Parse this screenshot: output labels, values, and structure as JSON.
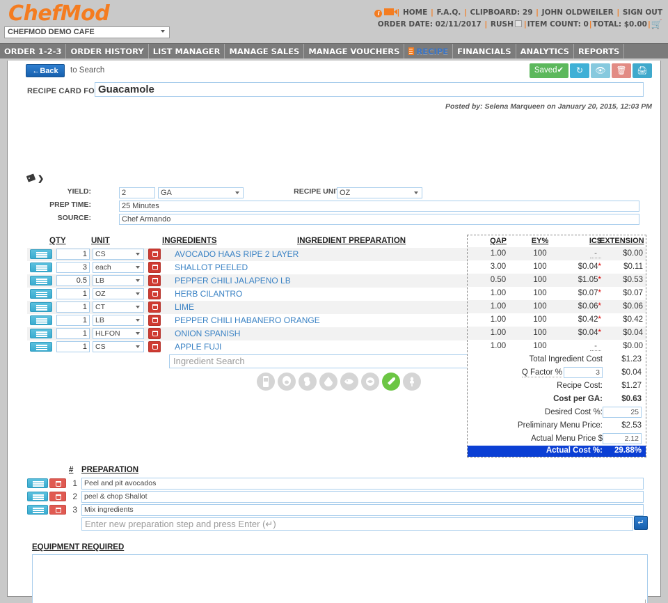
{
  "brand": {
    "logo": "ChefMod",
    "company": "CHEFMOD DEMO CAFE"
  },
  "header": {
    "links": [
      "HOME",
      "F.A.Q."
    ],
    "clipboard_label": "CLIPBOARD:",
    "clipboard_count": "29",
    "user": "JOHN OLDWEILER",
    "sign_out": "SIGN OUT",
    "order_date_label": "ORDER DATE:",
    "order_date": "02/11/2017",
    "rush_label": "RUSH",
    "item_count_label": "ITEM COUNT:",
    "item_count": "0",
    "total_label": "TOTAL:",
    "total": "$0.00",
    "separator": "|"
  },
  "nav": {
    "items": [
      {
        "label": "ORDER 1-2-3",
        "active": false
      },
      {
        "label": "ORDER HISTORY",
        "active": false
      },
      {
        "label": "LIST MANAGER",
        "active": false
      },
      {
        "label": "MANAGE SALES",
        "active": false
      },
      {
        "label": "MANAGE VOUCHERS",
        "active": false
      },
      {
        "label": "RECIPE",
        "active": true
      },
      {
        "label": "FINANCIALS",
        "active": false
      },
      {
        "label": "ANALYTICS",
        "active": false
      },
      {
        "label": "REPORTS",
        "active": false
      }
    ]
  },
  "toolbar": {
    "back_label": "←Back",
    "to_search_label": "to Search",
    "saved_label": "Saved✔",
    "refresh_icon": "refresh-icon",
    "eye_icon": "eye-icon",
    "trash_icon": "trash-icon",
    "print_icon": "print-icon"
  },
  "recipe": {
    "card_label": "RECIPE CARD FOR:",
    "name": "Guacamole",
    "posted_by": "Posted by: Selena Marqueen on January 20, 2015, 12:03 PM",
    "yield_label": "YIELD:",
    "yield_value": "2",
    "yield_unit": "GA",
    "recipe_unit_label": "RECIPE UNIT:",
    "recipe_unit": "OZ",
    "prep_time_label": "PREP TIME:",
    "prep_time": "25 Minutes",
    "source_label": "SOURCE:",
    "source": "Chef Armando"
  },
  "ingredients_table": {
    "headers": {
      "qty": "QTY",
      "unit": "UNIT",
      "ingredients": "INGREDIENTS",
      "preparation": "INGREDIENT PREPARATION",
      "qap": "QAP",
      "ey": "EY%",
      "ics": "IC$",
      "extension": "EXTENSION"
    },
    "rows": [
      {
        "qty": "1",
        "unit": "CS",
        "name": "AVOCADO HAAS RIPE 2 LAYER",
        "prep": "",
        "qap": "1.00",
        "ey": "100",
        "ics": "",
        "ics_star": false,
        "ext": "$0.00"
      },
      {
        "qty": "3",
        "unit": "each",
        "name": "SHALLOT PEELED",
        "prep": "",
        "qap": "3.00",
        "ey": "100",
        "ics": "$0.04",
        "ics_star": true,
        "ext": "$0.11"
      },
      {
        "qty": "0.5",
        "unit": "LB",
        "name": "PEPPER CHILI JALAPENO LB",
        "prep": "",
        "qap": "0.50",
        "ey": "100",
        "ics": "$1.05",
        "ics_star": true,
        "ext": "$0.53"
      },
      {
        "qty": "1",
        "unit": "OZ",
        "name": "HERB CILANTRO",
        "prep": "",
        "qap": "1.00",
        "ey": "100",
        "ics": "$0.07",
        "ics_star": true,
        "ext": "$0.07"
      },
      {
        "qty": "1",
        "unit": "CT",
        "name": "LIME",
        "prep": "",
        "qap": "1.00",
        "ey": "100",
        "ics": "$0.06",
        "ics_star": true,
        "ext": "$0.06"
      },
      {
        "qty": "1",
        "unit": "LB",
        "name": "PEPPER CHILI HABANERO ORANGE",
        "prep": "",
        "qap": "1.00",
        "ey": "100",
        "ics": "$0.42",
        "ics_star": true,
        "ext": "$0.42"
      },
      {
        "qty": "1",
        "unit": "HLFON",
        "name": "ONION SPANISH",
        "prep": "",
        "qap": "1.00",
        "ey": "100",
        "ics": "$0.04",
        "ics_star": true,
        "ext": "$0.04"
      },
      {
        "qty": "1",
        "unit": "CS",
        "name": "APPLE FUJI",
        "prep": "",
        "qap": "1.00",
        "ey": "100",
        "ics": "",
        "ics_star": false,
        "ext": "$0.00"
      }
    ],
    "search_placeholder": "Ingredient Search"
  },
  "allergens": [
    {
      "name": "milk-allergen-icon",
      "active": false
    },
    {
      "name": "egg-allergen-icon",
      "active": false
    },
    {
      "name": "peanut-allergen-icon",
      "active": false
    },
    {
      "name": "soy-allergen-icon",
      "active": false
    },
    {
      "name": "fish-allergen-icon",
      "active": false
    },
    {
      "name": "shellfish-allergen-icon",
      "active": false
    },
    {
      "name": "treenut-allergen-icon",
      "active": true
    },
    {
      "name": "wheat-allergen-icon",
      "active": false
    }
  ],
  "costs": {
    "total_ingredient_cost_label": "Total Ingredient Cost",
    "total_ingredient_cost": "$1.23",
    "q_factor_label": "Q Factor %",
    "q_factor_value": "3",
    "q_factor_cost": "$0.04",
    "recipe_cost_label": "Recipe Cost:",
    "recipe_cost": "$1.27",
    "cost_per_label": "Cost per GA:",
    "cost_per": "$0.63",
    "desired_cost_label": "Desired Cost %:",
    "desired_cost_value": "25",
    "prelim_price_label": "Preliminary Menu Price:",
    "prelim_price": "$2.53",
    "actual_price_label": "Actual Menu Price $",
    "actual_price_value": "2.12",
    "actual_cost_label": "Actual Cost %:",
    "actual_cost": "29.88%"
  },
  "preparation": {
    "num_header": "#",
    "header": "PREPARATION",
    "steps": [
      {
        "num": "1",
        "text": "Peel and pit avocados"
      },
      {
        "num": "2",
        "text": "peel & chop Shallot"
      },
      {
        "num": "3",
        "text": "Mix ingredients"
      }
    ],
    "new_placeholder": "Enter new preparation step and press Enter (↵)",
    "enter_label": "↵"
  },
  "equipment": {
    "header": "EQUIPMENT REQUIRED",
    "value": ""
  },
  "colors": {
    "brand_orange": "#f47c20",
    "nav_grey": "#7b7b7b",
    "link_blue": "#3a82c4",
    "saved_green": "#5cb85c",
    "highlight_blue": "#0b3fd4",
    "allergen_active": "#6cc644"
  }
}
